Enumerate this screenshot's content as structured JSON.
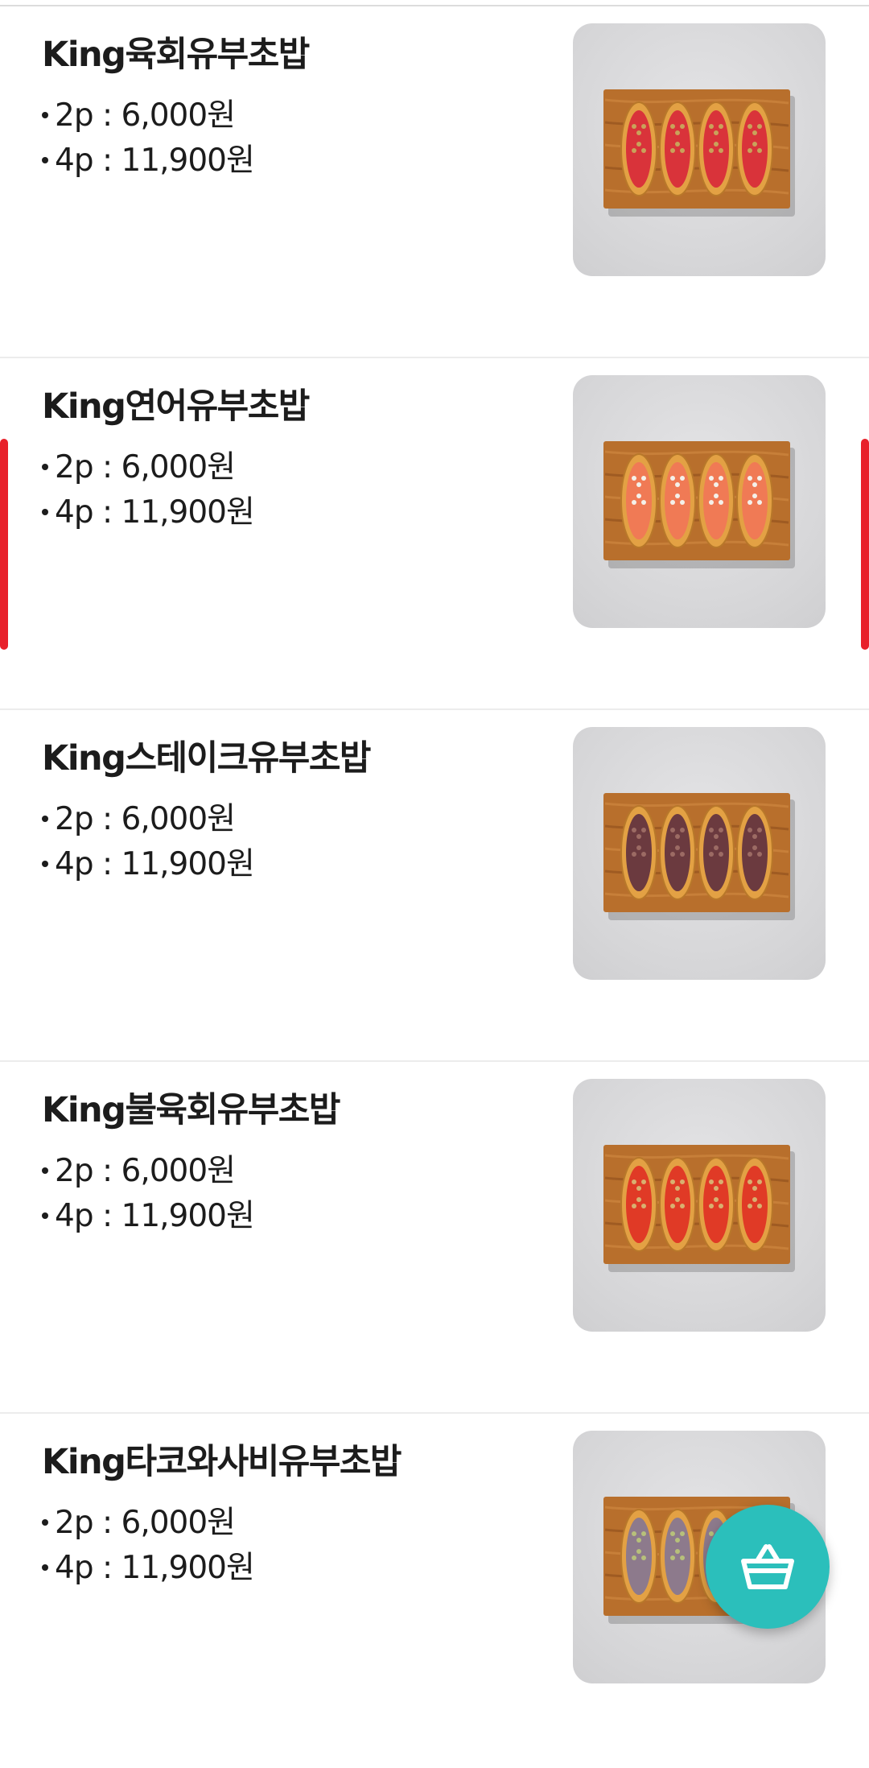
{
  "menu": {
    "items": [
      {
        "name": "King육회유부초밥",
        "prices": [
          {
            "label": "2p : 6,000원"
          },
          {
            "label": "4p : 11,900원"
          }
        ],
        "image_icon": "yubu-sushi-beef-tartare-image",
        "fill_color": "#d9333a",
        "topping_color": "#c9a25a"
      },
      {
        "name": "King연어유부초밥",
        "prices": [
          {
            "label": "2p : 6,000원"
          },
          {
            "label": "4p : 11,900원"
          }
        ],
        "image_icon": "yubu-sushi-salmon-image",
        "fill_color": "#f07a55",
        "topping_color": "#f4f1ea"
      },
      {
        "name": "King스테이크유부초밥",
        "prices": [
          {
            "label": "2p : 6,000원"
          },
          {
            "label": "4p : 11,900원"
          }
        ],
        "image_icon": "yubu-sushi-steak-image",
        "fill_color": "#6b3a3f",
        "topping_color": "#9c6b64"
      },
      {
        "name": "King불육회유부초밥",
        "prices": [
          {
            "label": "2p : 6,000원"
          },
          {
            "label": "4p : 11,900원"
          }
        ],
        "image_icon": "yubu-sushi-spicy-beef-tartare-image",
        "fill_color": "#e03a26",
        "topping_color": "#d8b070"
      },
      {
        "name": "King타코와사비유부초밥",
        "prices": [
          {
            "label": "2p : 6,000원"
          },
          {
            "label": "4p : 11,900원"
          }
        ],
        "image_icon": "yubu-sushi-tako-wasabi-image",
        "fill_color": "#8d7a8c",
        "topping_color": "#b7c07a"
      }
    ]
  },
  "cart_button": {
    "icon": "shopping-basket-icon",
    "color": "#2bbfbb"
  },
  "scroll_indicator": {
    "color": "#e8202a"
  }
}
